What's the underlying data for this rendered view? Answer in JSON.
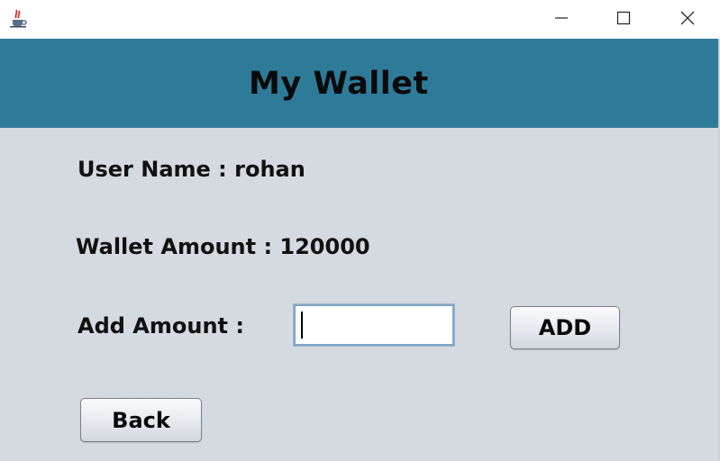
{
  "window": {
    "app_icon": "java-cup-icon",
    "controls": [
      "minimize-icon",
      "maximize-icon",
      "close-icon"
    ]
  },
  "header": {
    "title": "My Wallet",
    "bg_color": "#2e7b99"
  },
  "user": {
    "label": "User Name : rohan"
  },
  "wallet": {
    "label": "Wallet Amount : 120000"
  },
  "add_amount": {
    "label": "Add Amount :",
    "value": "",
    "button_label": "ADD"
  },
  "back_button": {
    "label": "Back"
  }
}
